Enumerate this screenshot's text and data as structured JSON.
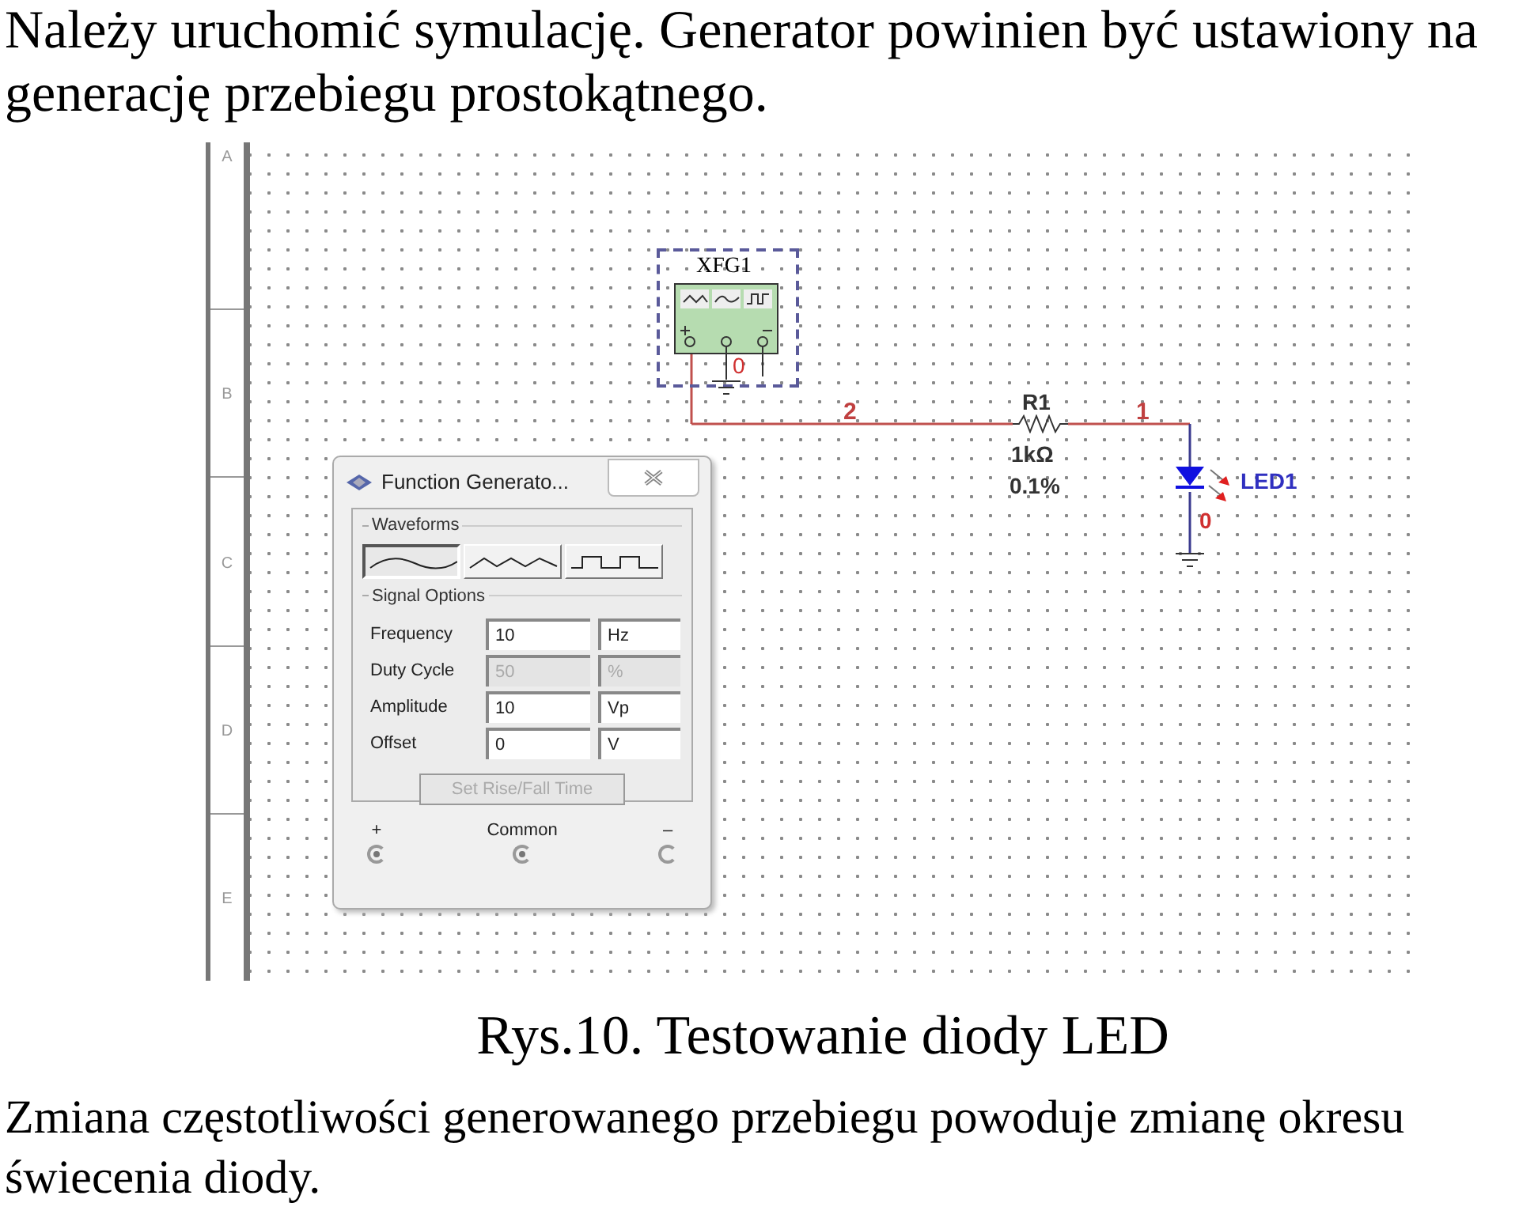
{
  "intro": "Należy uruchomić symulację. Generator powinien być ustawiony na generację przebiegu prostokątnego.",
  "schematic": {
    "ruler": [
      "A",
      "B",
      "C",
      "D",
      "E"
    ],
    "instrument": {
      "label": "XFG1",
      "node": "0"
    },
    "nets": [
      "2",
      "1"
    ],
    "resistor": {
      "name": "R1",
      "value": "1kΩ",
      "tolerance": "0.1%"
    },
    "led": {
      "name": "LED1",
      "node": "0"
    }
  },
  "dialog": {
    "title": "Function Generato...",
    "waveforms_label": "Waveforms",
    "waveforms": [
      {
        "kind": "sine",
        "selected": true
      },
      {
        "kind": "triangle",
        "selected": false
      },
      {
        "kind": "square",
        "selected": false
      }
    ],
    "signal_label": "Signal Options",
    "options": [
      {
        "label": "Frequency",
        "value": "10",
        "unit": "Hz",
        "disabled": false
      },
      {
        "label": "Duty Cycle",
        "value": "50",
        "unit": "%",
        "disabled": true
      },
      {
        "label": "Amplitude",
        "value": "10",
        "unit": "Vp",
        "disabled": false
      },
      {
        "label": "Offset",
        "value": "0",
        "unit": "V",
        "disabled": false
      }
    ],
    "rise_fall_button": {
      "label": "Set Rise/Fall Time",
      "disabled": true
    },
    "terminals": [
      {
        "label": "+",
        "connected": true
      },
      {
        "label": "Common",
        "connected": true
      },
      {
        "label": "–",
        "connected": false
      }
    ]
  },
  "caption": "Rys.10. Testowanie diody LED",
  "paragraph": "Zmiana częstotliwości generowanego przebiegu powoduje zmianę okresu świecenia diody."
}
